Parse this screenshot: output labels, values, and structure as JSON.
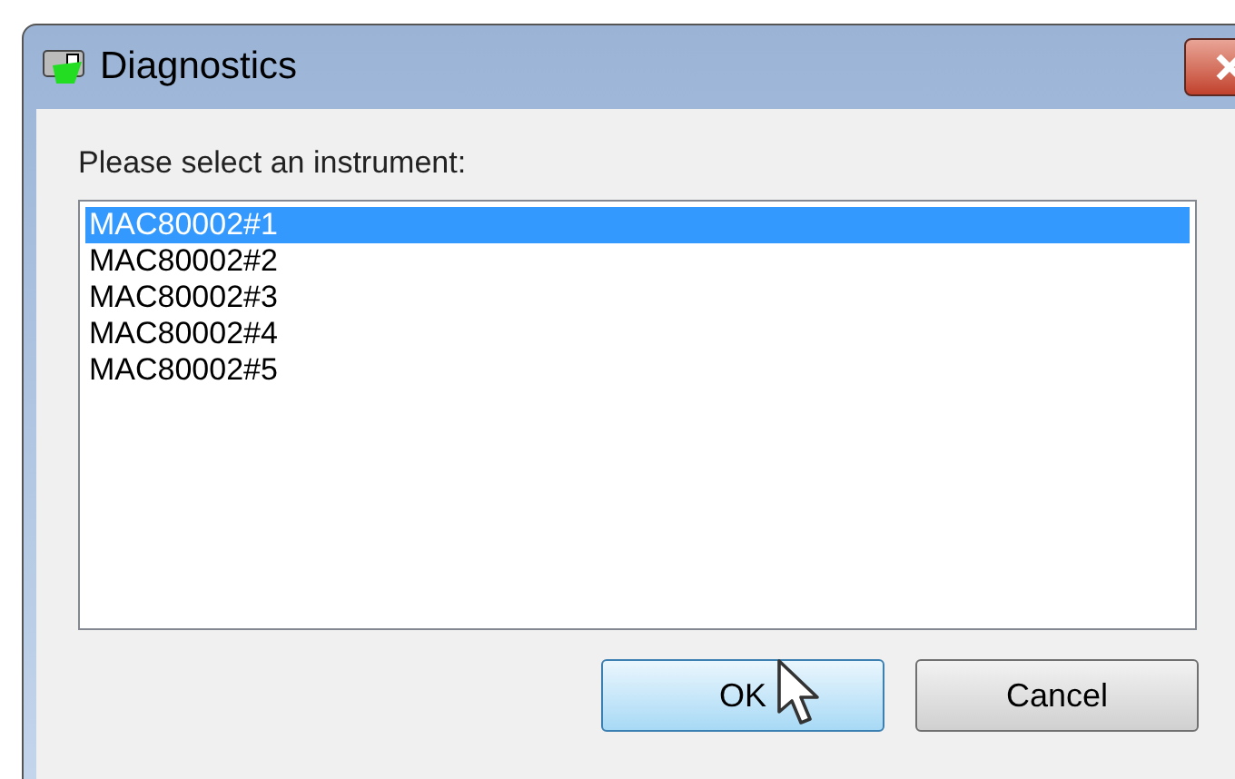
{
  "window": {
    "title": "Diagnostics"
  },
  "prompt": "Please select an instrument:",
  "instruments": [
    {
      "label": "MAC80002#1",
      "selected": true
    },
    {
      "label": "MAC80002#2",
      "selected": false
    },
    {
      "label": "MAC80002#3",
      "selected": false
    },
    {
      "label": "MAC80002#4",
      "selected": false
    },
    {
      "label": "MAC80002#5",
      "selected": false
    }
  ],
  "buttons": [
    {
      "label": "OK",
      "hovered": true
    },
    {
      "label": "Cancel",
      "hovered": false
    }
  ]
}
